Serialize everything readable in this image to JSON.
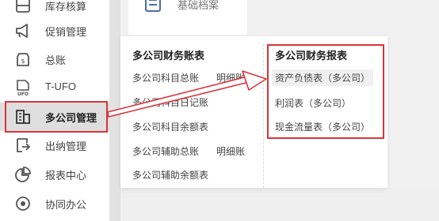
{
  "top_card": {
    "label": "基础档案"
  },
  "sidebar": {
    "items": [
      {
        "label": "库存核算",
        "icon": "inventory-icon"
      },
      {
        "label": "促销管理",
        "icon": "megaphone-icon"
      },
      {
        "label": "总账",
        "icon": "ledger-coin-icon"
      },
      {
        "label": "T-UFO",
        "icon": "ufo-doc-icon"
      },
      {
        "label": "多公司管理",
        "icon": "building-icon"
      },
      {
        "label": "出纳管理",
        "icon": "cashier-icon"
      },
      {
        "label": "报表中心",
        "icon": "pie-chart-icon"
      },
      {
        "label": "协同办公",
        "icon": "collab-icon"
      }
    ]
  },
  "menu": {
    "left_column": {
      "heading": "多公司财务账表",
      "links": [
        {
          "label": "多公司科目总账"
        },
        {
          "label": "明细账"
        },
        {
          "label": "多公司科目日记账"
        },
        {
          "label": "多公司科目余额表"
        },
        {
          "label": "多公司辅助总账"
        },
        {
          "label": "明细账"
        },
        {
          "label": "多公司辅助余额表"
        }
      ]
    },
    "right_column": {
      "heading": "多公司财务报表",
      "links": [
        {
          "label": "资产负债表（多公司）"
        },
        {
          "label": "利润表（多公司）"
        },
        {
          "label": "现金流量表（多公司）"
        }
      ]
    }
  },
  "colors": {
    "annotation_red": "#d9343a"
  }
}
